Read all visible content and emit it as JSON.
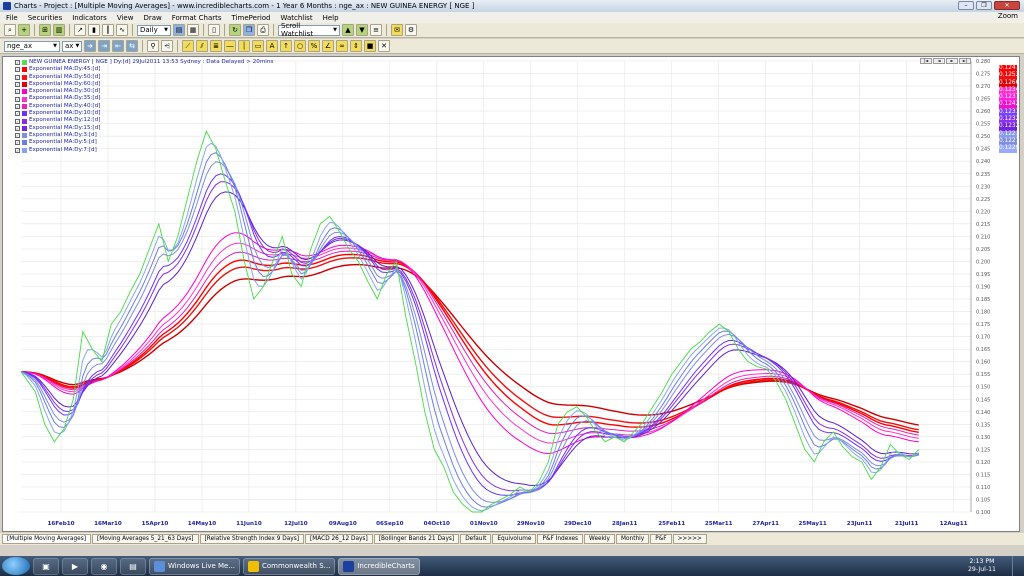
{
  "window": {
    "title": "Charts - Project : [Multiple Moving Averages] - www.incrediblecharts.com - 1 Year 6 Months : nge_ax : NEW GUINEA ENERGY  [ NGE ]",
    "controls": [
      "–",
      "❐",
      "✕"
    ]
  },
  "menu": {
    "items": [
      "File",
      "Securities",
      "Indicators",
      "View",
      "Draw",
      "Format Charts",
      "TimePeriod",
      "Watchlist",
      "Help"
    ],
    "zoom_label": "Zoom"
  },
  "toolbar1": {
    "period_value": "Daily",
    "watchlist_value": "Scroll Watchlist"
  },
  "toolbar2": {
    "symbol_value": "nge_ax",
    "exchange_value": "ax"
  },
  "chart": {
    "header": "NEW GUINEA ENERGY [ NGE ] Dy:[d]  29Jul2011 13:53 Sydney : Data Delayed > 20mins",
    "legend": [
      {
        "label": "Exponential MA:Dy:45:[d]",
        "color": "#ff0000"
      },
      {
        "label": "Exponential MA:Dy:50:[d]",
        "color": "#ff1010"
      },
      {
        "label": "Exponential MA:Dy:60:[d]",
        "color": "#e00000"
      },
      {
        "label": "Exponential MA:Dy:30:[d]",
        "color": "#ff00cc"
      },
      {
        "label": "Exponential MA:Dy:35:[d]",
        "color": "#ff33cc"
      },
      {
        "label": "Exponential MA:Dy:40:[d]",
        "color": "#ee22bb"
      },
      {
        "label": "Exponential MA:Dy:10:[d]",
        "color": "#6633ff"
      },
      {
        "label": "Exponential MA:Dy:12:[d]",
        "color": "#8a2be2"
      },
      {
        "label": "Exponential MA:Dy:15:[d]",
        "color": "#7b22dd"
      },
      {
        "label": "Exponential MA:Dy:3:[d]",
        "color": "#7f8fd8"
      },
      {
        "label": "Exponential MA:Dy:5:[d]",
        "color": "#6a7fe0"
      },
      {
        "label": "Exponential MA:Dy:7:[d]",
        "color": "#8aa0f0"
      }
    ],
    "current_values": [
      {
        "value": "0.1247",
        "color": "#ff0000"
      },
      {
        "value": "0.1253",
        "color": "#ee1111"
      },
      {
        "value": "0.1266",
        "color": "#dd0000"
      },
      {
        "value": "0.1234",
        "color": "#ff33cc"
      },
      {
        "value": "0.1237",
        "color": "#ff22dd"
      },
      {
        "value": "0.1242",
        "color": "#ee11cc"
      },
      {
        "value": "0.1231",
        "color": "#7744ff"
      },
      {
        "value": "0.1232",
        "color": "#8833ee"
      },
      {
        "value": "0.1232",
        "color": "#7722dd"
      },
      {
        "value": "0.1221",
        "color": "#8899ee"
      },
      {
        "value": "0.1227",
        "color": "#7f8fdd"
      },
      {
        "value": "0.1229",
        "color": "#99aaff"
      }
    ],
    "nav_buttons": [
      "|◄",
      "◄",
      "►",
      "►|"
    ]
  },
  "chart_data": {
    "type": "line",
    "x_tick_labels": [
      "16Feb10",
      "16Mar10",
      "15Apr10",
      "14May10",
      "11Jun10",
      "12Jul10",
      "09Aug10",
      "06Sep10",
      "04Oct10",
      "01Nov10",
      "29Nov10",
      "29Dec10",
      "28Jan11",
      "25Feb11",
      "25Mar11",
      "27Apr11",
      "25May11",
      "23Jun11",
      "21Jul11",
      "12Aug11"
    ],
    "y_tick_labels": [
      "0.280",
      "0.275",
      "0.270",
      "0.265",
      "0.260",
      "0.255",
      "0.250",
      "0.245",
      "0.240",
      "0.235",
      "0.230",
      "0.225",
      "0.220",
      "0.215",
      "0.210",
      "0.205",
      "0.200",
      "0.195",
      "0.190",
      "0.185",
      "0.180",
      "0.175",
      "0.170",
      "0.165",
      "0.160",
      "0.155",
      "0.150",
      "0.145",
      "0.140",
      "0.135",
      "0.130",
      "0.125",
      "0.120",
      "0.115",
      "0.110",
      "0.105",
      "0.100"
    ],
    "ylim": [
      0.1,
      0.28
    ],
    "price": [
      [
        0,
        0.156
      ],
      [
        3,
        0.148
      ],
      [
        5,
        0.135
      ],
      [
        7,
        0.128
      ],
      [
        9,
        0.133
      ],
      [
        11,
        0.145
      ],
      [
        13,
        0.172
      ],
      [
        15,
        0.165
      ],
      [
        17,
        0.16
      ],
      [
        19,
        0.175
      ],
      [
        21,
        0.18
      ],
      [
        23,
        0.188
      ],
      [
        25,
        0.195
      ],
      [
        27,
        0.205
      ],
      [
        29,
        0.215
      ],
      [
        31,
        0.2
      ],
      [
        33,
        0.21
      ],
      [
        35,
        0.225
      ],
      [
        37,
        0.24
      ],
      [
        39,
        0.252
      ],
      [
        41,
        0.245
      ],
      [
        43,
        0.232
      ],
      [
        45,
        0.22
      ],
      [
        47,
        0.2
      ],
      [
        49,
        0.185
      ],
      [
        51,
        0.19
      ],
      [
        53,
        0.2
      ],
      [
        55,
        0.21
      ],
      [
        57,
        0.195
      ],
      [
        59,
        0.19
      ],
      [
        61,
        0.205
      ],
      [
        63,
        0.215
      ],
      [
        65,
        0.218
      ],
      [
        67,
        0.212
      ],
      [
        69,
        0.205
      ],
      [
        71,
        0.2
      ],
      [
        73,
        0.192
      ],
      [
        75,
        0.185
      ],
      [
        77,
        0.195
      ],
      [
        79,
        0.2
      ],
      [
        81,
        0.178
      ],
      [
        83,
        0.16
      ],
      [
        85,
        0.14
      ],
      [
        87,
        0.125
      ],
      [
        89,
        0.118
      ],
      [
        91,
        0.108
      ],
      [
        93,
        0.103
      ],
      [
        95,
        0.1
      ],
      [
        97,
        0.1
      ],
      [
        99,
        0.103
      ],
      [
        101,
        0.105
      ],
      [
        103,
        0.107
      ],
      [
        105,
        0.11
      ],
      [
        107,
        0.108
      ],
      [
        109,
        0.112
      ],
      [
        111,
        0.12
      ],
      [
        113,
        0.135
      ],
      [
        115,
        0.14
      ],
      [
        117,
        0.142
      ],
      [
        119,
        0.138
      ],
      [
        121,
        0.132
      ],
      [
        123,
        0.128
      ],
      [
        125,
        0.13
      ],
      [
        127,
        0.128
      ],
      [
        129,
        0.132
      ],
      [
        131,
        0.136
      ],
      [
        133,
        0.142
      ],
      [
        135,
        0.148
      ],
      [
        137,
        0.155
      ],
      [
        139,
        0.16
      ],
      [
        141,
        0.165
      ],
      [
        143,
        0.168
      ],
      [
        145,
        0.172
      ],
      [
        147,
        0.175
      ],
      [
        149,
        0.172
      ],
      [
        151,
        0.165
      ],
      [
        153,
        0.16
      ],
      [
        155,
        0.158
      ],
      [
        157,
        0.157
      ],
      [
        159,
        0.152
      ],
      [
        161,
        0.145
      ],
      [
        163,
        0.135
      ],
      [
        165,
        0.125
      ],
      [
        167,
        0.12
      ],
      [
        169,
        0.128
      ],
      [
        171,
        0.132
      ],
      [
        173,
        0.126
      ],
      [
        175,
        0.122
      ],
      [
        177,
        0.12
      ],
      [
        179,
        0.113
      ],
      [
        181,
        0.118
      ],
      [
        183,
        0.127
      ],
      [
        185,
        0.123
      ],
      [
        187,
        0.121
      ],
      [
        189,
        0.125
      ]
    ],
    "ma_lengths": [
      3,
      5,
      7,
      10,
      12,
      15,
      30,
      35,
      40,
      45,
      50,
      60
    ],
    "ma_colors": [
      "#8aa6f0",
      "#6a7fe0",
      "#7c8ce8",
      "#6633ff",
      "#8a2be2",
      "#5a20d0",
      "#ff00cc",
      "#ff33cc",
      "#e020b8",
      "#ff0000",
      "#ee1111",
      "#cc0000"
    ],
    "price_color": "#44dd44"
  },
  "tabs": [
    "[Multiple Moving Averages]",
    "[Moving Averages 5_21_63 Days]",
    "[Relative Strength Index 9 Days]",
    "[MACD 26_12 Days]",
    "[Bollinger Bands 21 Days]",
    "Default",
    "Equivolume",
    "P&F Indexes",
    "Weekly",
    "Monthly",
    "P&F",
    ">>>>>"
  ],
  "taskbar": {
    "tasks": [
      {
        "label": "Windows Live Me...",
        "color": "#5b8fdc"
      },
      {
        "label": "Commonwealth S...",
        "color": "#f0c000"
      },
      {
        "label": "IncredibleCharts",
        "color": "#1a3f9c"
      }
    ],
    "time": "2:13 PM",
    "date": "29-Jul-11"
  }
}
